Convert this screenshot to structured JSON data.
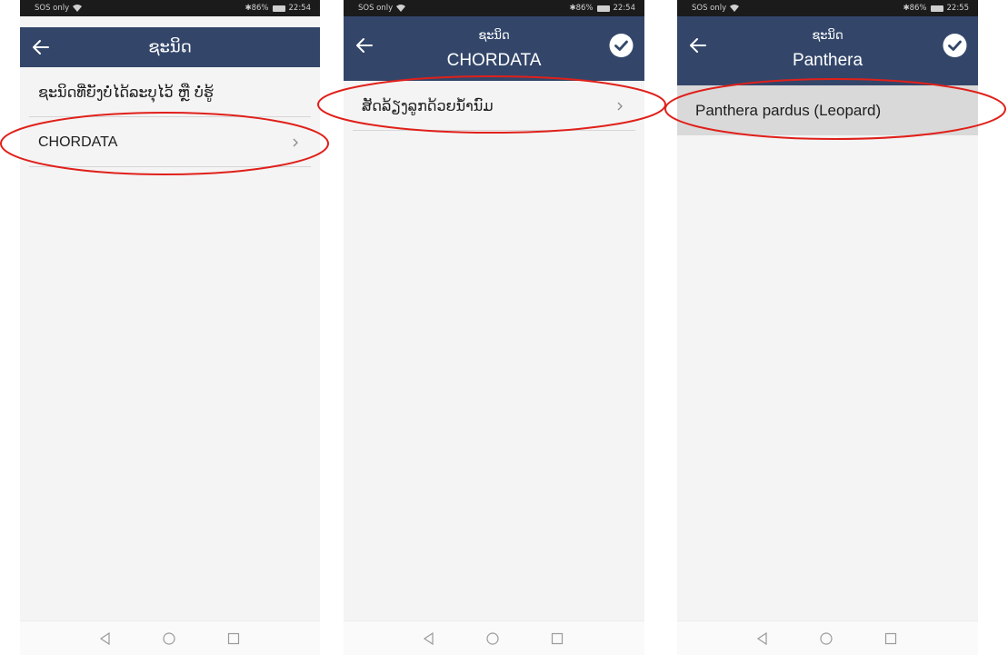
{
  "status_bars": {
    "p1": {
      "left": "SOS only",
      "right": "✱86%",
      "time": "22:54"
    },
    "p2": {
      "left": "SOS only",
      "right": "✱86%",
      "time": "22:54"
    },
    "p3": {
      "left": "SOS only",
      "right": "✱86%",
      "time": "22:55"
    }
  },
  "screens": [
    {
      "title": "ຊະນິດ",
      "items": [
        {
          "label": "ຊະນິດທີ່ຍັງບໍ່ໄດ້ລະບຸໄວ້ ຫຼື ບໍ່ຮູ້",
          "chevron": false
        },
        {
          "label": "CHORDATA",
          "chevron": true
        }
      ]
    },
    {
      "title": "ຊະນິດ",
      "subtitle": "CHORDATA",
      "items": [
        {
          "label": "ສັດລ້ຽງລູກດ້ວຍນ້ຳນົມ",
          "chevron": true
        }
      ]
    },
    {
      "title": "ຊະນິດ",
      "subtitle": "Panthera",
      "items": [
        {
          "label": "Panthera pardus (Leopard)",
          "chevron": false,
          "selected": true
        }
      ]
    }
  ],
  "icons": {
    "back": "arrow-left-icon",
    "confirm": "check-circle-icon",
    "row_more": "chevron-right-icon",
    "nav_back": "triangle-back-icon",
    "nav_home": "circle-home-icon",
    "nav_recent": "square-recent-icon"
  },
  "colors": {
    "header": "#33466a",
    "status_bar": "#1b1b1b",
    "background": "#f4f4f4",
    "selected_row": "#d9d9d9",
    "annotation": "#e0201a"
  }
}
